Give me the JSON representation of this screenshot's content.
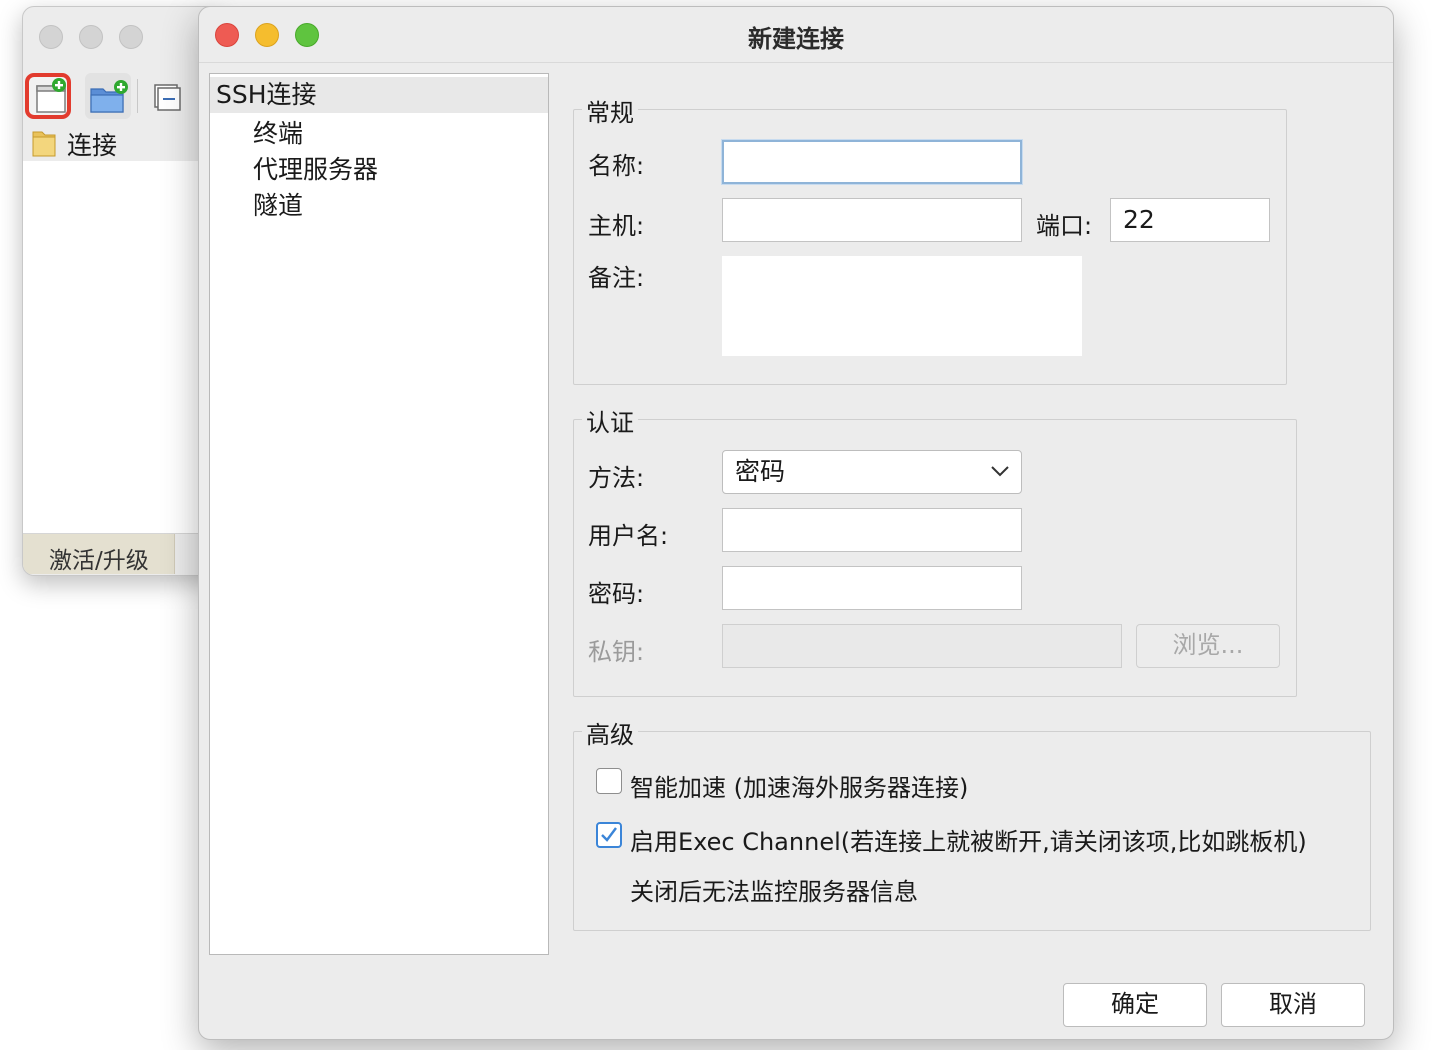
{
  "main_window": {
    "tree_item": "连接",
    "activate_label": "激活/升级"
  },
  "dialog": {
    "title": "新建连接",
    "nav": {
      "ssh": "SSH连接",
      "terminal": "终端",
      "proxy": "代理服务器",
      "tunnel": "隧道"
    },
    "general": {
      "legend": "常规",
      "name_label": "名称:",
      "name_value": "",
      "host_label": "主机:",
      "host_value": "",
      "port_label": "端口:",
      "port_value": "22",
      "note_label": "备注:",
      "note_value": ""
    },
    "auth": {
      "legend": "认证",
      "method_label": "方法:",
      "method_value": "密码",
      "username_label": "用户名:",
      "username_value": "",
      "password_label": "密码:",
      "password_value": "",
      "key_label": "私钥:",
      "key_value": "",
      "browse_label": "浏览..."
    },
    "advanced": {
      "legend": "高级",
      "accel_label": "智能加速 (加速海外服务器连接)",
      "accel_checked": false,
      "exec_label": "启用Exec Channel(若连接上就被断开,请关闭该项,比如跳板机)",
      "exec_checked": true,
      "exec_note": "关闭后无法监控服务器信息"
    },
    "ok_label": "确定",
    "cancel_label": "取消"
  },
  "colors": {
    "highlight_border": "#e23b2e",
    "check_accent": "#3b85d8",
    "close": "#ee5b53",
    "minimize": "#f5bd2e",
    "zoom": "#5fc43f"
  }
}
